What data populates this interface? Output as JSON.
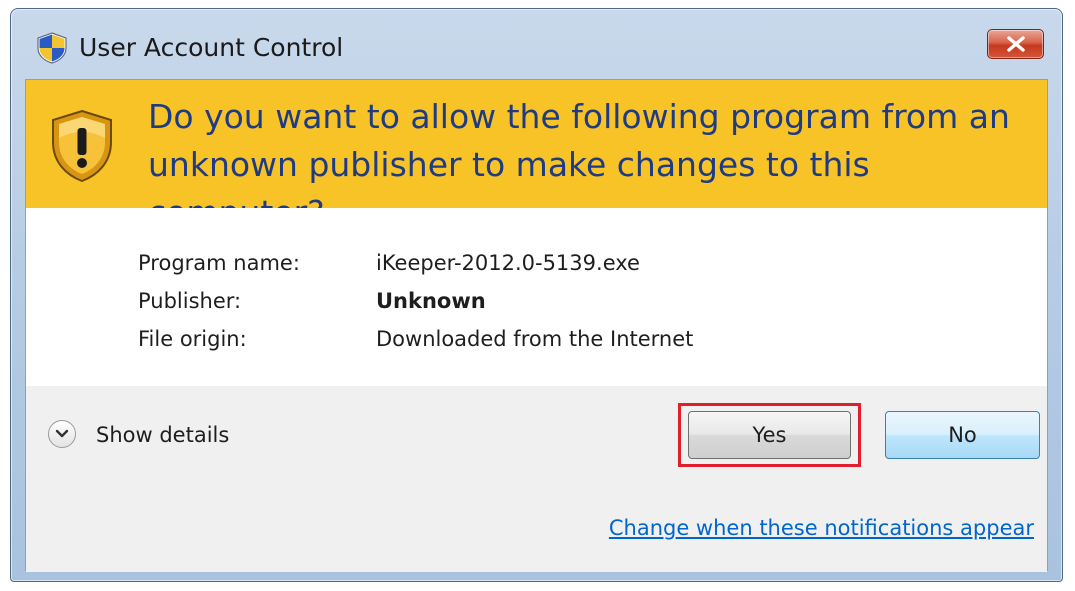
{
  "window": {
    "title": "User Account Control",
    "close_icon": "close-x-icon"
  },
  "banner": {
    "question": "Do you want to allow the following program from an unknown publisher to make changes to this computer?",
    "icon": "warning-shield-icon",
    "color": "#f8c326"
  },
  "info": {
    "rows": [
      {
        "label": "Program name:",
        "value": "iKeeper-2012.0-5139.exe"
      },
      {
        "label": "Publisher:",
        "value": "Unknown"
      },
      {
        "label": "File origin:",
        "value": "Downloaded from the Internet"
      }
    ]
  },
  "actions": {
    "show_details": "Show details",
    "yes_label": "Yes",
    "no_label": "No",
    "highlight_color": "#e01e2c"
  },
  "footer": {
    "link": "Change when these notifications appear",
    "link_color": "#0066cc"
  }
}
